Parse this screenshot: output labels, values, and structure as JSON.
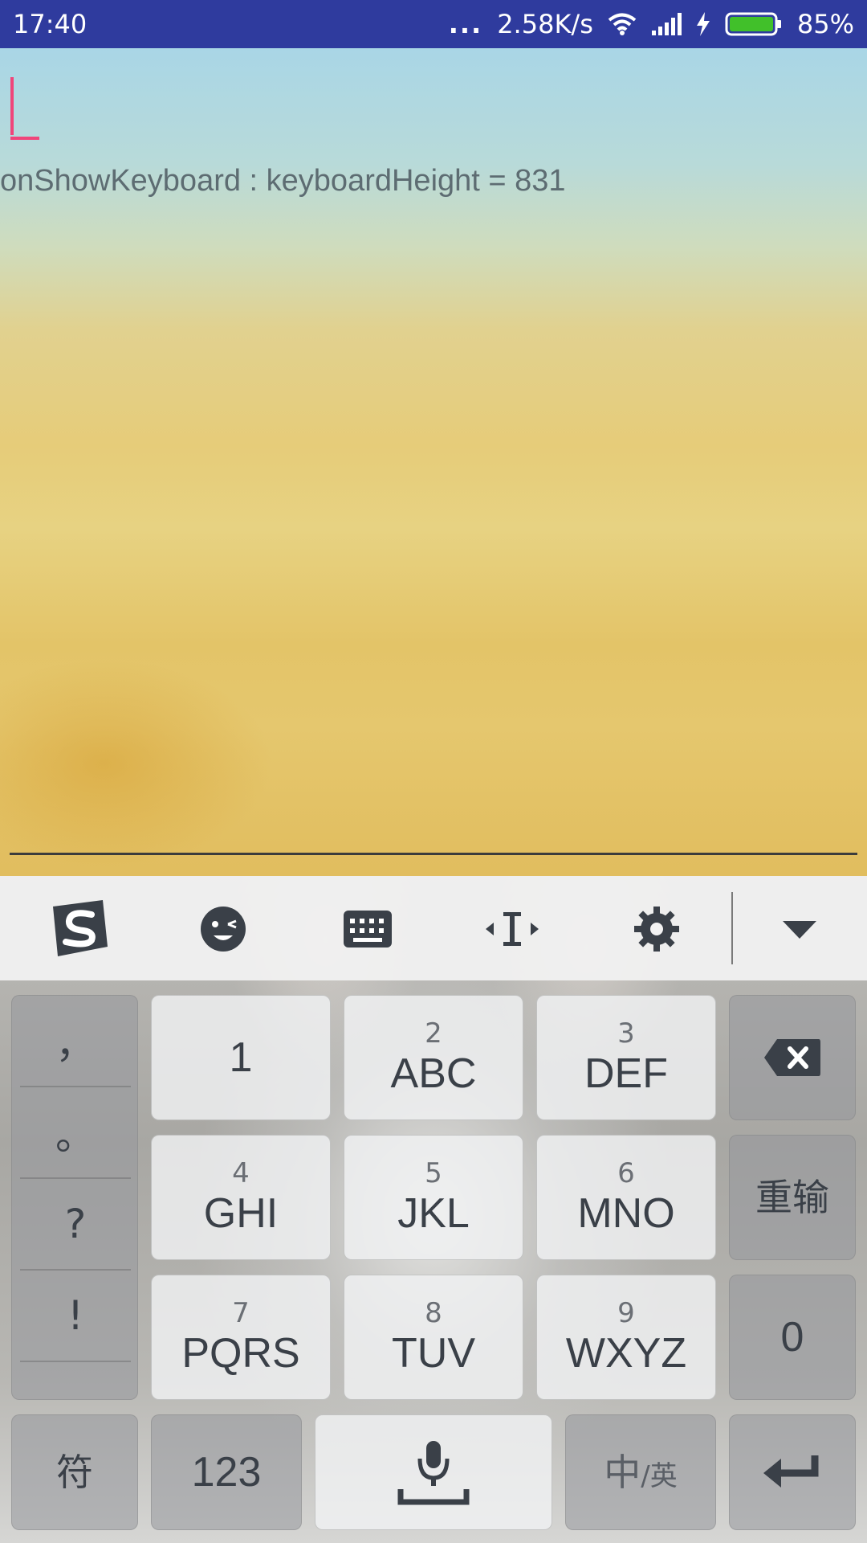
{
  "status_bar": {
    "time": "17:40",
    "dots": "...",
    "net_speed": "2.58K/s",
    "battery_percent": "85%",
    "battery_level": 0.85,
    "icons": [
      "wifi-icon",
      "signal-icon",
      "charging-icon",
      "battery-icon"
    ]
  },
  "app": {
    "log_text": "onShowKeyboard : keyboardHeight = 831",
    "cursor_color": "#f0457a"
  },
  "keyboard": {
    "toolbar": {
      "icons": [
        "sogou-logo-icon",
        "emoji-icon",
        "keyboard-icon",
        "cursor-move-icon",
        "gear-icon",
        "chevron-down-icon"
      ]
    },
    "punctuation": [
      "，",
      "。",
      "?",
      "!"
    ],
    "keys": {
      "k1": {
        "main": "1"
      },
      "k2": {
        "sub": "2",
        "main": "ABC"
      },
      "k3": {
        "sub": "3",
        "main": "DEF"
      },
      "k4": {
        "sub": "4",
        "main": "GHI"
      },
      "k5": {
        "sub": "5",
        "main": "JKL"
      },
      "k6": {
        "sub": "6",
        "main": "MNO"
      },
      "k7": {
        "sub": "7",
        "main": "PQRS"
      },
      "k8": {
        "sub": "8",
        "main": "TUV"
      },
      "k9": {
        "sub": "9",
        "main": "WXYZ"
      },
      "reenter": "重输",
      "zero": "0",
      "symbols": "符",
      "num123": "123",
      "lang_main": "中",
      "lang_sub": "/英"
    }
  }
}
